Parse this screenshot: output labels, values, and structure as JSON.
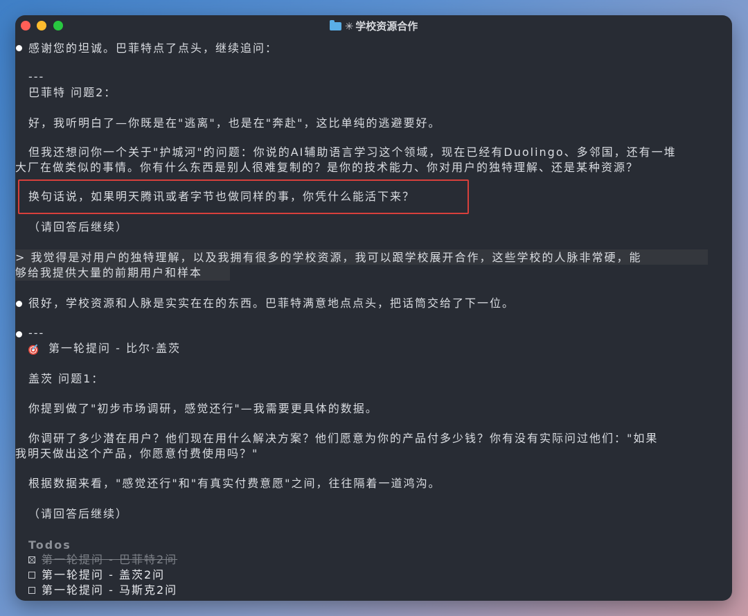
{
  "window": {
    "title": "学校资源合作",
    "spark": "✳"
  },
  "transcript": {
    "p1_intro": "感谢您的坦诚。巴菲特点了点头，继续追问：",
    "p1_sep": "---",
    "p1_heading": "巴菲特 问题2：",
    "p1_para1": "好，我听明白了—你既是在\"逃离\"，也是在\"奔赴\"，这比单纯的逃避要好。",
    "p1_para2_l1": "但我还想问你一个关于\"护城河\"的问题：你说的AI辅助语言学习这个领域，现在已经有Duolingo、多邻国，还有一堆",
    "p1_para2_l2": "大厂在做类似的事情。你有什么东西是别人很难复制的？是你的技术能力、你对用户的独特理解、还是某种资源？",
    "p1_para3": "换句话说，如果明天腾讯或者字节也做同样的事，你凭什么能活下来？",
    "p1_prompt": "（请回答后继续）",
    "user_l1": "> 我觉得是对用户的独特理解，以及我拥有很多的学校资源，我可以跟学校展开合作，这些学校的人脉非常硬，能",
    "user_l2": "够给我提供大量的前期用户和样本",
    "p2_intro": "很好，学校资源和人脉是实实在在的东西。巴菲特满意地点点头，把话筒交给了下一位。",
    "p3_sep": "---",
    "p3_round": "第一轮提问 - 比尔·盖茨",
    "p3_heading": "盖茨 问题1：",
    "p3_para1": "你提到做了\"初步市场调研，感觉还行\"—我需要更具体的数据。",
    "p3_para2_l1": "你调研了多少潜在用户？他们现在用什么解决方案？他们愿意为你的产品付多少钱？你有没有实际问过他们：\"如果",
    "p3_para2_l2": "我明天做出这个产品，你愿意付费使用吗？\"",
    "p3_para3": "根据数据来看，\"感觉还行\"和\"有真实付费意愿\"之间，往往隔着一道鸿沟。",
    "p3_prompt": "（请回答后继续）"
  },
  "todos": {
    "label": "Todos",
    "items": [
      {
        "text": "第一轮提问 - 巴菲特2问",
        "done": true
      },
      {
        "text": "第一轮提问 - 盖茨2问",
        "done": false
      },
      {
        "text": "第一轮提问 - 马斯克2问",
        "done": false
      }
    ]
  }
}
